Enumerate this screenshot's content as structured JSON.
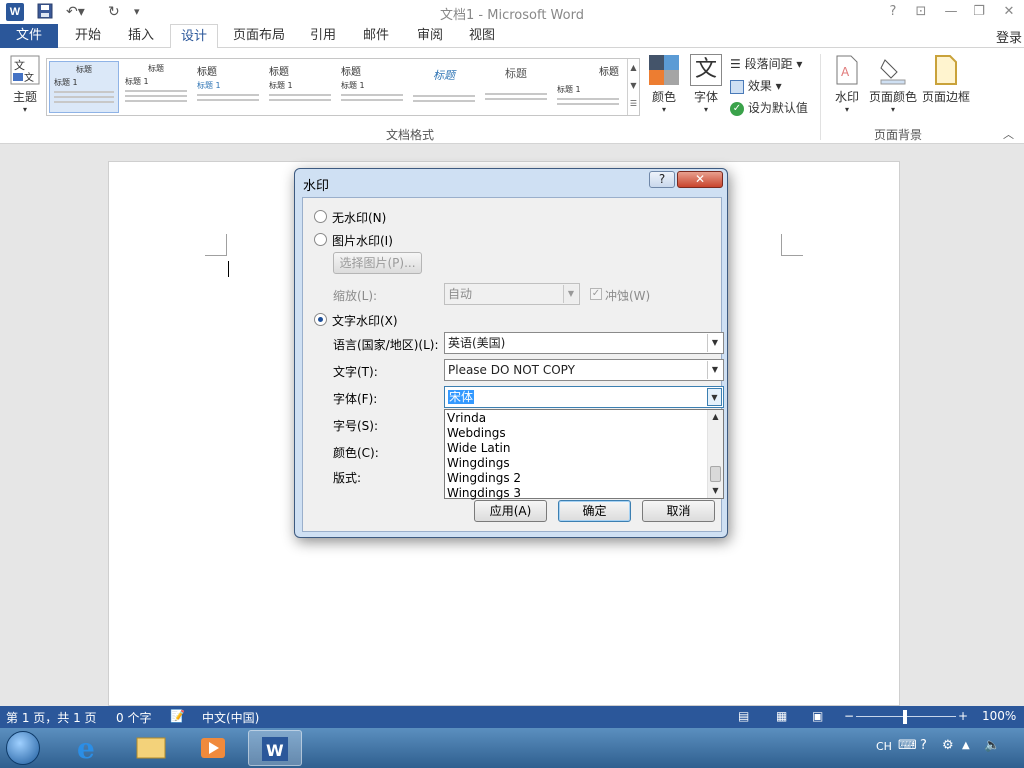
{
  "titlebar": {
    "title": "文档1 - Microsoft Word",
    "word_icon": "W",
    "buttons": {
      "help": "?",
      "restore_ribbon": "⊡",
      "minimize": "—",
      "maximize": "❐",
      "close": "✕"
    }
  },
  "tabs": {
    "file": "文件",
    "items": [
      "开始",
      "插入",
      "设计",
      "页面布局",
      "引用",
      "邮件",
      "审阅",
      "视图"
    ],
    "active": "设计",
    "login": "登录"
  },
  "ribbon": {
    "theme_label": "主题",
    "gallery": [
      {
        "heading": "标题",
        "sub": "标题 1"
      },
      {
        "heading": "标题",
        "sub": "标题 1"
      },
      {
        "heading": "标题",
        "sub": "标题 1"
      },
      {
        "heading": "标题",
        "sub": "标题 1"
      },
      {
        "heading": "标题",
        "sub": "标题 1"
      },
      {
        "heading": "标题",
        "sub": ""
      },
      {
        "heading": "标题",
        "sub": ""
      },
      {
        "heading": "标题",
        "sub": "标题 1"
      }
    ],
    "colors_label": "颜色",
    "fonts_label": "字体",
    "fonts_glyph": "文",
    "paragraph_spacing_label": "段落间距",
    "effects_label": "效果",
    "set_default_label": "设为默认值",
    "doc_format_group": "文档格式",
    "watermark_label": "水印",
    "page_color_label": "页面颜色",
    "page_border_label": "页面边框",
    "page_background_group": "页面背景"
  },
  "dialog": {
    "title": "水印",
    "help_btn": "?",
    "close_btn": "✕",
    "no_watermark": "无水印(N)",
    "picture_watermark": "图片水印(I)",
    "select_picture_btn": "选择图片(P)...",
    "scale_label": "缩放(L):",
    "scale_value": "自动",
    "washout_label": "冲蚀(W)",
    "text_watermark": "文字水印(X)",
    "language_label": "语言(国家/地区)(L):",
    "language_value": "英语(美国)",
    "text_label": "文字(T):",
    "text_value": "Please DO NOT COPY",
    "font_label": "字体(F):",
    "font_value": "宋体",
    "size_label": "字号(S):",
    "color_label": "颜色(C):",
    "layout_label": "版式:",
    "font_dropdown_items": [
      "Vrinda",
      "Webdings",
      "Wide Latin",
      "Wingdings",
      "Wingdings 2",
      "Wingdings 3"
    ],
    "apply_btn": "应用(A)",
    "ok_btn": "确定",
    "cancel_btn": "取消",
    "selected_option": "text"
  },
  "statusbar": {
    "page_info": "第 1 页，共 1 页",
    "word_count": "0 个字",
    "language": "中文(中国)",
    "zoom": "100%",
    "zoom_level": 1.0
  },
  "taskbar": {
    "ime": "CH"
  },
  "colors": {
    "accent": "#2b579a",
    "dialog_frame": "#cfe0f3",
    "close_red": "#c9442c",
    "selection": "#3399ff"
  }
}
